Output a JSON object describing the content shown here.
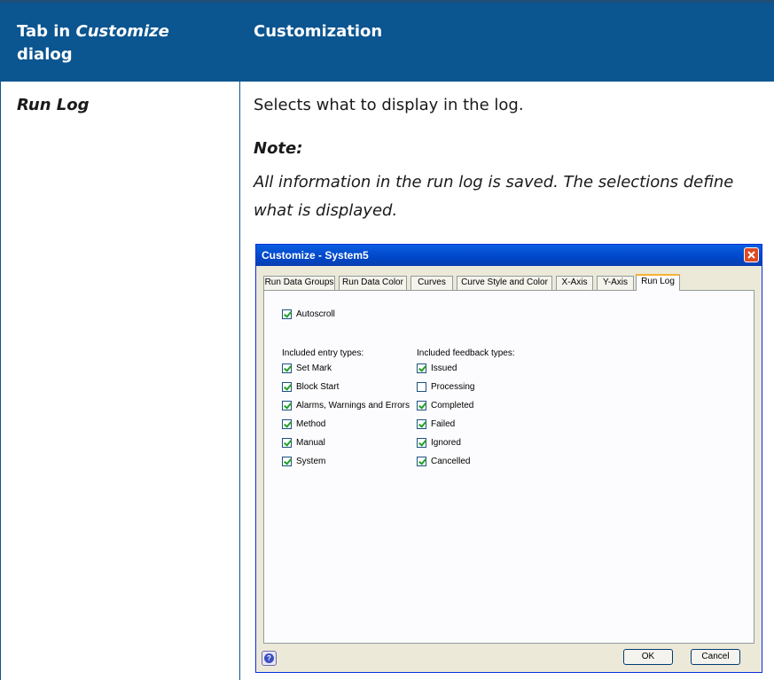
{
  "table": {
    "header": {
      "col1_prefix": "Tab in ",
      "col1_em": "Customize",
      "col1_suffix": "dialog",
      "col2": "Customization"
    },
    "row": {
      "label": "Run Log",
      "description": "Selects what to display in the log.",
      "note_title": "Note:",
      "note_text": "All information in the run log is saved. The selections define what is displayed."
    },
    "colors": {
      "header_bg": "#0b5590",
      "header_text": "#ffffff"
    }
  },
  "dialog": {
    "title": "Customize - System5",
    "tabs": [
      {
        "label": "Run Data Groups"
      },
      {
        "label": "Run Data Color"
      },
      {
        "label": "Curves"
      },
      {
        "label": "Curve Style and Color"
      },
      {
        "label": "X-Axis"
      },
      {
        "label": "Y-Axis"
      },
      {
        "label": "Run Log"
      }
    ],
    "active_tab": "Run Log",
    "autoscroll": {
      "label": "Autoscroll",
      "checked": true
    },
    "entry_types": {
      "heading": "Included entry types:",
      "items": [
        {
          "label": "Set Mark",
          "checked": true
        },
        {
          "label": "Block Start",
          "checked": true
        },
        {
          "label": "Alarms, Warnings and Errors",
          "checked": true
        },
        {
          "label": "Method",
          "checked": true
        },
        {
          "label": "Manual",
          "checked": true
        },
        {
          "label": "System",
          "checked": true
        }
      ]
    },
    "feedback_types": {
      "heading": "Included feedback types:",
      "items": [
        {
          "label": "Issued",
          "checked": true
        },
        {
          "label": "Processing",
          "checked": false
        },
        {
          "label": "Completed",
          "checked": true
        },
        {
          "label": "Failed",
          "checked": true
        },
        {
          "label": "Ignored",
          "checked": true
        },
        {
          "label": "Cancelled",
          "checked": true
        }
      ]
    },
    "buttons": {
      "ok": "OK",
      "cancel": "Cancel"
    },
    "icons": {
      "help": "help-icon",
      "close": "close-icon"
    }
  }
}
